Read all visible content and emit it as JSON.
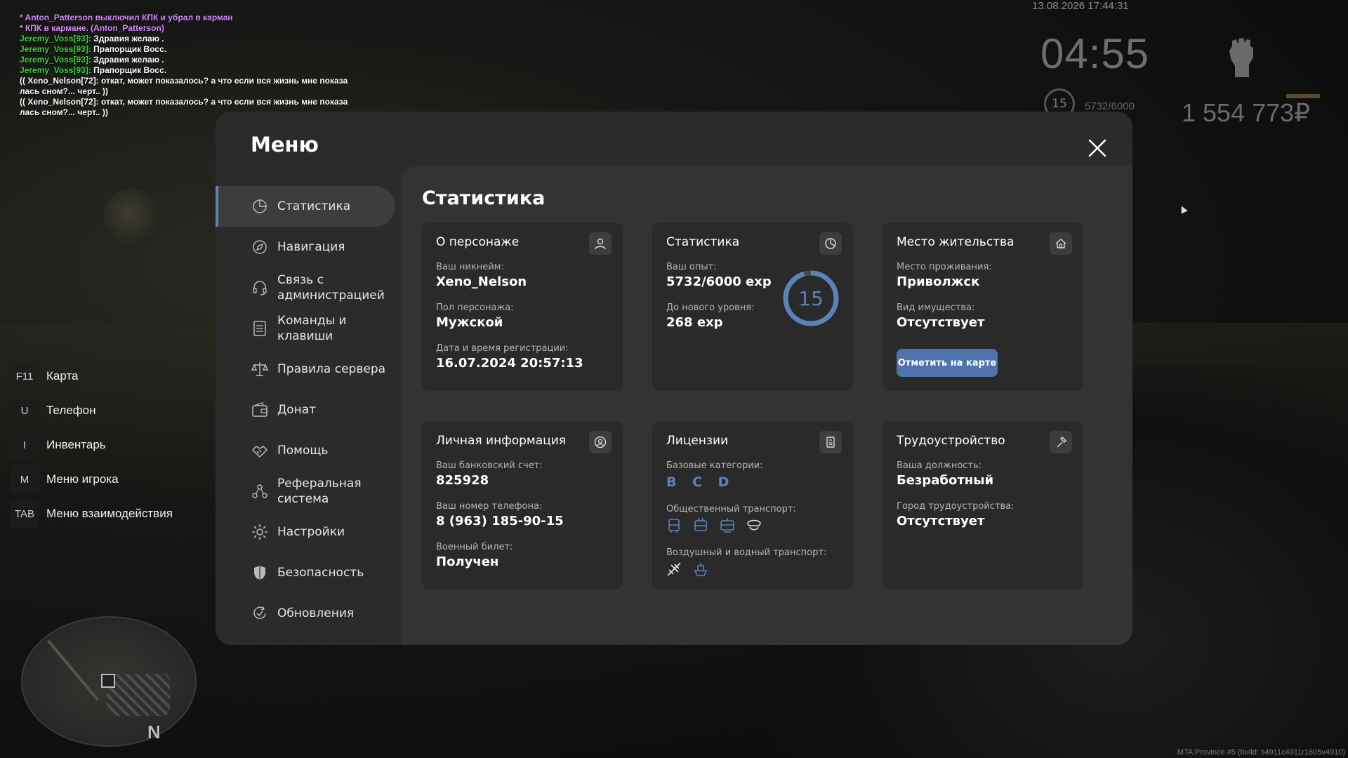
{
  "chat": [
    {
      "parts": [
        {
          "cls": "c-purple",
          "text": "* Anton_Patterson выключил КПК и убрал в карман"
        }
      ]
    },
    {
      "parts": [
        {
          "cls": "c-purple",
          "text": "* КПК в кармане. (Anton_Patterson)"
        }
      ]
    },
    {
      "parts": [
        {
          "cls": "c-name",
          "text": "Jeremy_Voss[93]: "
        },
        {
          "cls": "c-white",
          "text": "Здравия желаю ."
        }
      ]
    },
    {
      "parts": [
        {
          "cls": "c-name",
          "text": "Jeremy_Voss[93]: "
        },
        {
          "cls": "c-white",
          "text": "Прапорщик Восс."
        }
      ]
    },
    {
      "parts": [
        {
          "cls": "c-name",
          "text": "Jeremy_Voss[93]: "
        },
        {
          "cls": "c-white",
          "text": "Здравия желаю ."
        }
      ]
    },
    {
      "parts": [
        {
          "cls": "c-name",
          "text": "Jeremy_Voss[93]: "
        },
        {
          "cls": "c-white",
          "text": "Прапорщик Восс."
        }
      ]
    },
    {
      "parts": [
        {
          "cls": "c-white",
          "text": "(( Xeno_Nelson[72]: откат, может показалось? а что если вся жизнь мне показа\nлась сном?... черт.. ))"
        }
      ]
    },
    {
      "parts": [
        {
          "cls": "c-white",
          "text": "(( Xeno_Nelson[72]: откат, может показалось? а что если вся жизнь мне показа\nлась сном?... черт.. ))"
        }
      ]
    }
  ],
  "hud": {
    "datetime": "13.08.2026 17:44:31",
    "clock": "04:55",
    "level": "15",
    "exp": "5732/6000",
    "money": "1 554 773₽"
  },
  "keybinds": [
    {
      "key": "F11",
      "label": "Карта"
    },
    {
      "key": "U",
      "label": "Телефон"
    },
    {
      "key": "I",
      "label": "Инвентарь"
    },
    {
      "key": "M",
      "label": "Меню игрока"
    },
    {
      "key": "TAB",
      "label": "Меню взаимодействия"
    }
  ],
  "compass": "N",
  "build": "MTA Province #5 (build: s4911c4911r1605v4910)",
  "menu": {
    "title": "Меню",
    "nav": [
      {
        "label": "Статистика",
        "icon": "pie-chart-icon",
        "active": true
      },
      {
        "label": "Навигация",
        "icon": "compass-icon"
      },
      {
        "label": "Связь с\nадминистрацией",
        "icon": "headset-icon"
      },
      {
        "label": "Команды и\nклавиши",
        "icon": "list-icon"
      },
      {
        "label": "Правила сервера",
        "icon": "scales-icon"
      },
      {
        "label": "Донат",
        "icon": "wallet-icon"
      },
      {
        "label": "Помощь",
        "icon": "handshake-icon"
      },
      {
        "label": "Реферальная\nсистема",
        "icon": "referral-icon"
      },
      {
        "label": "Настройки",
        "icon": "gear-icon"
      },
      {
        "label": "Безопасность",
        "icon": "shield-icon"
      },
      {
        "label": "Обновления",
        "icon": "update-icon"
      }
    ],
    "content_title": "Статистика",
    "cards": {
      "character": {
        "title": "О персонаже",
        "nickname_label": "Ваш никнейм:",
        "nickname": "Xeno_Nelson",
        "gender_label": "Пол персонажа:",
        "gender": "Мужской",
        "reg_label": "Дата и время регистрации:",
        "reg": "16.07.2024 20:57:13"
      },
      "stats": {
        "title": "Статистика",
        "exp_label": "Ваш опыт:",
        "exp": "5732/6000 exp",
        "next_label": "До нового уровня:",
        "next": "268 exp",
        "level": "15",
        "progress": 0.955
      },
      "residence": {
        "title": "Место жительства",
        "place_label": "Место проживания:",
        "place": "Приволжск",
        "property_label": "Вид имущества:",
        "property": "Отсутствует",
        "button": "Отметить на карте"
      },
      "personal": {
        "title": "Личная информация",
        "bank_label": "Ваш банковский счет:",
        "bank": "825928",
        "phone_label": "Ваш номер телефона:",
        "phone": "8 (963) 185-90-15",
        "military_label": "Военный билет:",
        "military": "Получен"
      },
      "licenses": {
        "title": "Лицензии",
        "base_label": "Базовые категории:",
        "base": "B C D",
        "public_label": "Общественный транспорт:",
        "public_icons": [
          "bus-icon",
          "trolleybus-icon",
          "tram-icon",
          "driver-cap-icon"
        ],
        "air_label": "Воздушный и водный транспорт:",
        "air_icons": [
          "plane-icon",
          "boat-icon"
        ]
      },
      "job": {
        "title": "Трудоустройство",
        "position_label": "Ваша должность:",
        "position": "Безработный",
        "city_label": "Город трудоустройства:",
        "city": "Отсутствует"
      }
    }
  },
  "colors": {
    "accent": "#5b83b8",
    "button": "#4f74ad",
    "name_green": "#38d23a",
    "purple": "#d78bff"
  }
}
